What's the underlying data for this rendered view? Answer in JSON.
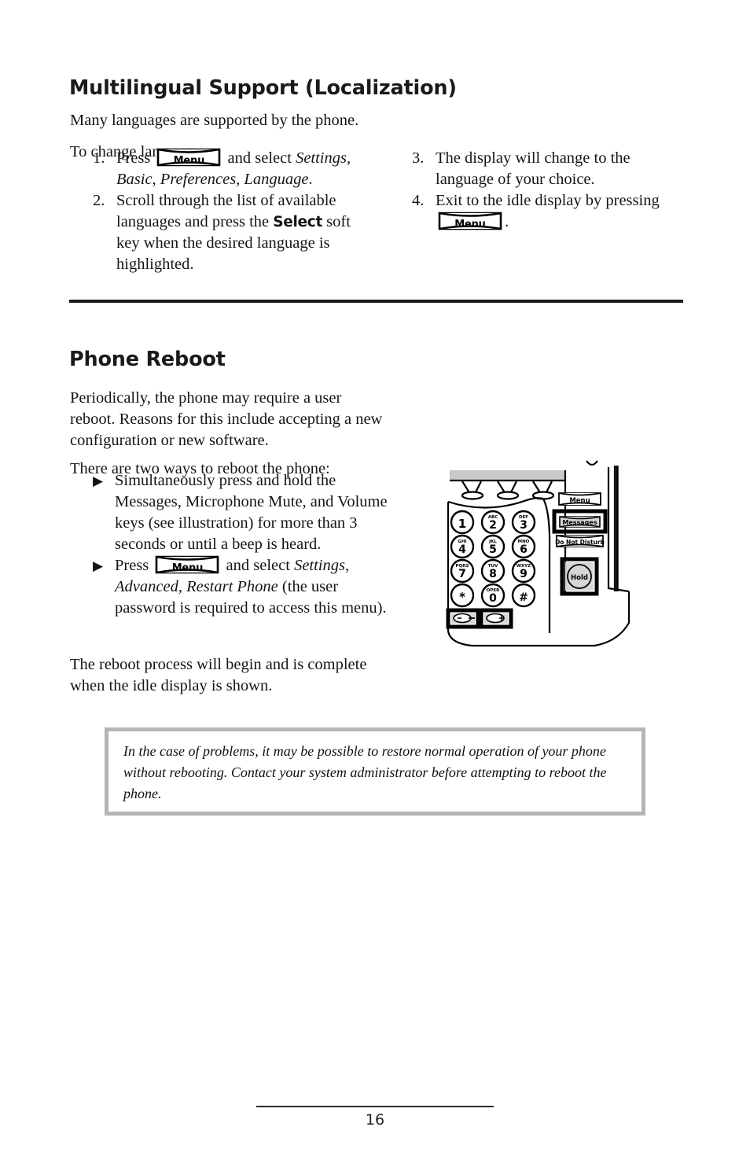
{
  "document": {
    "page_number": "16"
  },
  "sections": [
    {
      "id": "multilingual",
      "heading": "Multilingual Support (Localization)",
      "intro_1": "Many languages are supported by the phone.",
      "intro_2": "To change language:",
      "steps_left": [
        {
          "number": "1.",
          "pre_text": "Press ",
          "key_label": "Menu",
          "post_text": " and select ",
          "italic_text": "Settings, Basic, Preferences, Language",
          "tail_text": "."
        },
        {
          "number": "2.",
          "pre_text": "Scroll through the list of available languages and press the ",
          "emphasis": "Select",
          "post_text": " soft key when the desired language is highlighted."
        }
      ],
      "steps_right": [
        {
          "number": "3.",
          "text": "The display will change to the language of your choice."
        },
        {
          "number": "4.",
          "pre_text": "Exit to the idle display by pressing ",
          "key_label": "Menu",
          "post_text": "."
        }
      ]
    },
    {
      "id": "reboot",
      "heading": "Phone Reboot",
      "intro_1": "Periodically, the phone may require a user reboot.  Reasons for this include accepting a new configuration or new software.",
      "intro_2": "There are two ways to reboot the phone:",
      "bullets": [
        {
          "marker": "▶",
          "text": "Simultaneously press and hold the Messages, Microphone Mute, and Volume keys (see illustration) for more than 3 seconds or until a beep is heard."
        },
        {
          "marker": "▶",
          "pre_text": "Press ",
          "key_label": "Menu",
          "post_text": " and select ",
          "italic_text": "Settings, Advanced, Restart Phone",
          "tail_text": " (the user password is required to access this menu)."
        }
      ],
      "closing": "The reboot process will begin and is complete when the idle display is shown."
    }
  ],
  "note": {
    "text": "In the case of problems, it may be possible to restore normal operation of your phone without rebooting.  Contact your system administrator before attempting to reboot the phone.",
    "border_color": "#b5b5b5"
  },
  "illustration": {
    "name": "phone-keypad-diagram",
    "keypad": [
      {
        "letters": "",
        "digit": "1"
      },
      {
        "letters": "ABC",
        "digit": "2"
      },
      {
        "letters": "DEF",
        "digit": "3"
      },
      {
        "letters": "GHI",
        "digit": "4"
      },
      {
        "letters": "JKL",
        "digit": "5"
      },
      {
        "letters": "MNO",
        "digit": "6"
      },
      {
        "letters": "PQRS",
        "digit": "7"
      },
      {
        "letters": "TUV",
        "digit": "8"
      },
      {
        "letters": "WXYZ",
        "digit": "9"
      },
      {
        "letters": "",
        "digit": "∗"
      },
      {
        "letters": "OPER",
        "digit": "0"
      },
      {
        "letters": "",
        "digit": "#"
      }
    ],
    "side_buttons": [
      {
        "label": "Menu",
        "highlighted": false
      },
      {
        "label": "Messages",
        "highlighted": true
      },
      {
        "label": "Do Not Disturb",
        "highlighted": false
      },
      {
        "label": "Hold",
        "highlighted": true
      }
    ],
    "volume_keys": [
      {
        "label": "volume-down",
        "highlighted": true
      },
      {
        "label": "volume-up",
        "highlighted": true
      }
    ],
    "colors": {
      "button_fill": "#d6d6d6",
      "display_bar": "#c9c9c9",
      "outline": "#000000"
    }
  }
}
